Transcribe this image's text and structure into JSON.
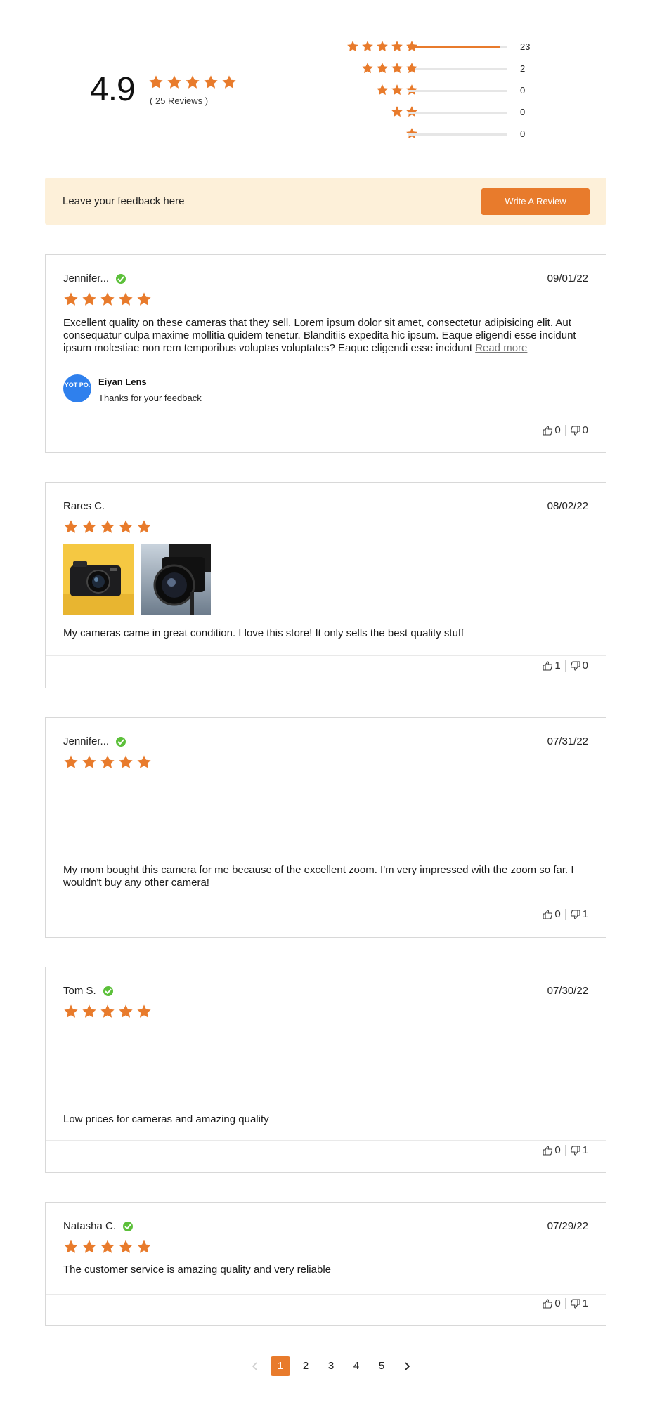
{
  "summary": {
    "average": "4.9",
    "review_count_label": "( 25 Reviews )",
    "distribution": [
      {
        "stars": 5,
        "count": "23",
        "fraction": 0.92
      },
      {
        "stars": 4,
        "count": "2",
        "fraction": 0.08
      },
      {
        "stars": 3,
        "count": "0",
        "fraction": 0
      },
      {
        "stars": 2,
        "count": "0",
        "fraction": 0
      },
      {
        "stars": 1,
        "count": "0",
        "fraction": 0
      }
    ]
  },
  "banner": {
    "text": "Leave your feedback here",
    "button_label": "Write A Review"
  },
  "reviews": [
    {
      "name": "Jennifer...",
      "verified": true,
      "date": "09/01/22",
      "rating": 5,
      "body": "Excellent quality on these cameras that they sell. Lorem ipsum dolor sit amet, consectetur adipisicing elit. Aut consequatur culpa maxime mollitia quidem tenetur. Blanditiis expedita hic ipsum. Eaque eligendi esse incidunt ipsum molestiae non rem temporibus voluptas voluptates?  Eaque eligendi esse incidunt",
      "read_more": "Read more",
      "reply_logo": "YOT PO.",
      "reply_name": "Eiyan Lens",
      "reply_text": "Thanks for your feedback",
      "up": "0",
      "down": "0"
    },
    {
      "name": "Rares C.",
      "verified": false,
      "date": "08/02/22",
      "rating": 5,
      "body": "My cameras came in great condition. I love this store! It only sells the best quality stuff",
      "up": "1",
      "down": "0"
    },
    {
      "name": "Jennifer...",
      "verified": true,
      "date": "07/31/22",
      "rating": 5,
      "body": "My mom bought this camera for me because of the excellent zoom. I'm very impressed with the zoom so far. I wouldn't buy any other camera!",
      "up": "0",
      "down": "1"
    },
    {
      "name": "Tom S.",
      "verified": true,
      "date": "07/30/22",
      "rating": 5,
      "body": "Low prices for cameras and amazing quality",
      "up": "0",
      "down": "1"
    },
    {
      "name": "Natasha C.",
      "verified": true,
      "date": "07/29/22",
      "rating": 5,
      "body": "The customer service is amazing quality and very reliable",
      "up": "0",
      "down": "1"
    }
  ],
  "pagination": {
    "pages": [
      "1",
      "2",
      "3",
      "4",
      "5"
    ],
    "current": "1"
  },
  "colors": {
    "accent": "#e87b2c",
    "banner_bg": "#fdf0d9",
    "verified": "#5cc03a",
    "yotpo_blue": "#2f80ed"
  },
  "icons": {
    "star": "star-icon",
    "verified": "verified-check-icon",
    "thumbs_up": "thumbs-up-icon",
    "thumbs_down": "thumbs-down-icon",
    "prev": "chevron-left-icon",
    "next": "chevron-right-icon"
  }
}
